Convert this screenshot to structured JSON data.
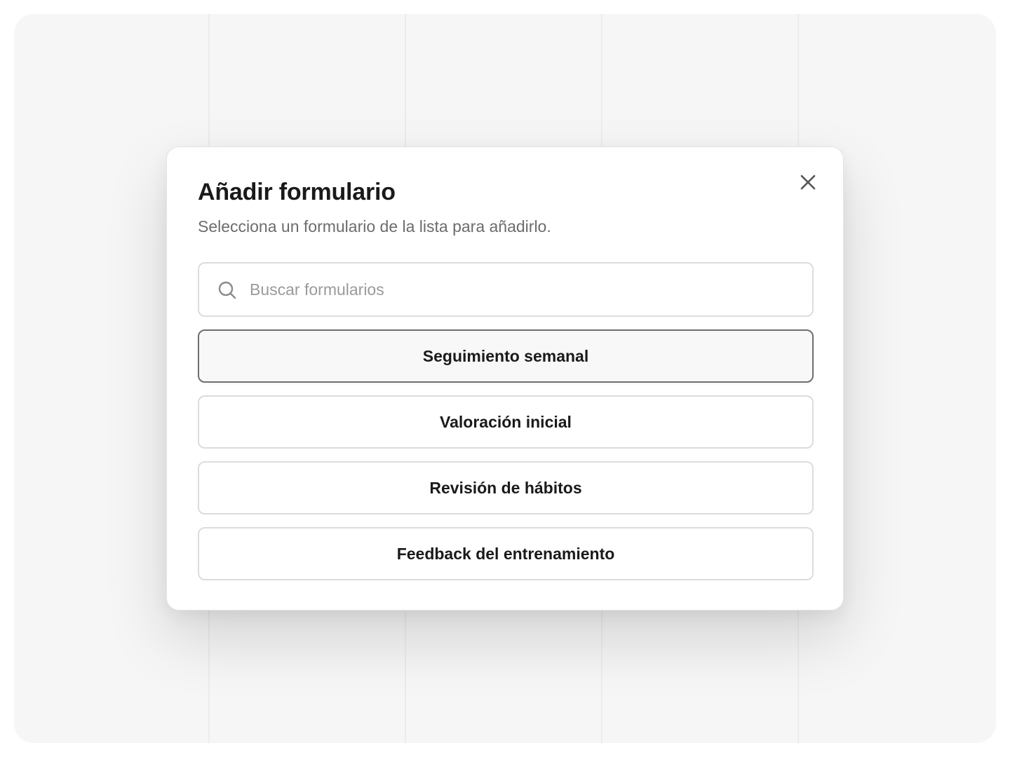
{
  "dialog": {
    "title": "Añadir formulario",
    "subtitle": "Selecciona un formulario de la lista para añadirlo.",
    "close_icon": "close-icon"
  },
  "search": {
    "placeholder": "Buscar formularios",
    "value": "",
    "icon": "search-icon"
  },
  "forms": [
    {
      "label": "Seguimiento semanal",
      "selected": true
    },
    {
      "label": "Valoración inicial",
      "selected": false
    },
    {
      "label": "Revisión de hábitos",
      "selected": false
    },
    {
      "label": "Feedback del entrenamiento",
      "selected": false
    }
  ],
  "colors": {
    "text_primary": "#1a1a1a",
    "text_secondary": "#6c6c6c",
    "border": "#dcdcdc",
    "selected_border": "#707070"
  }
}
